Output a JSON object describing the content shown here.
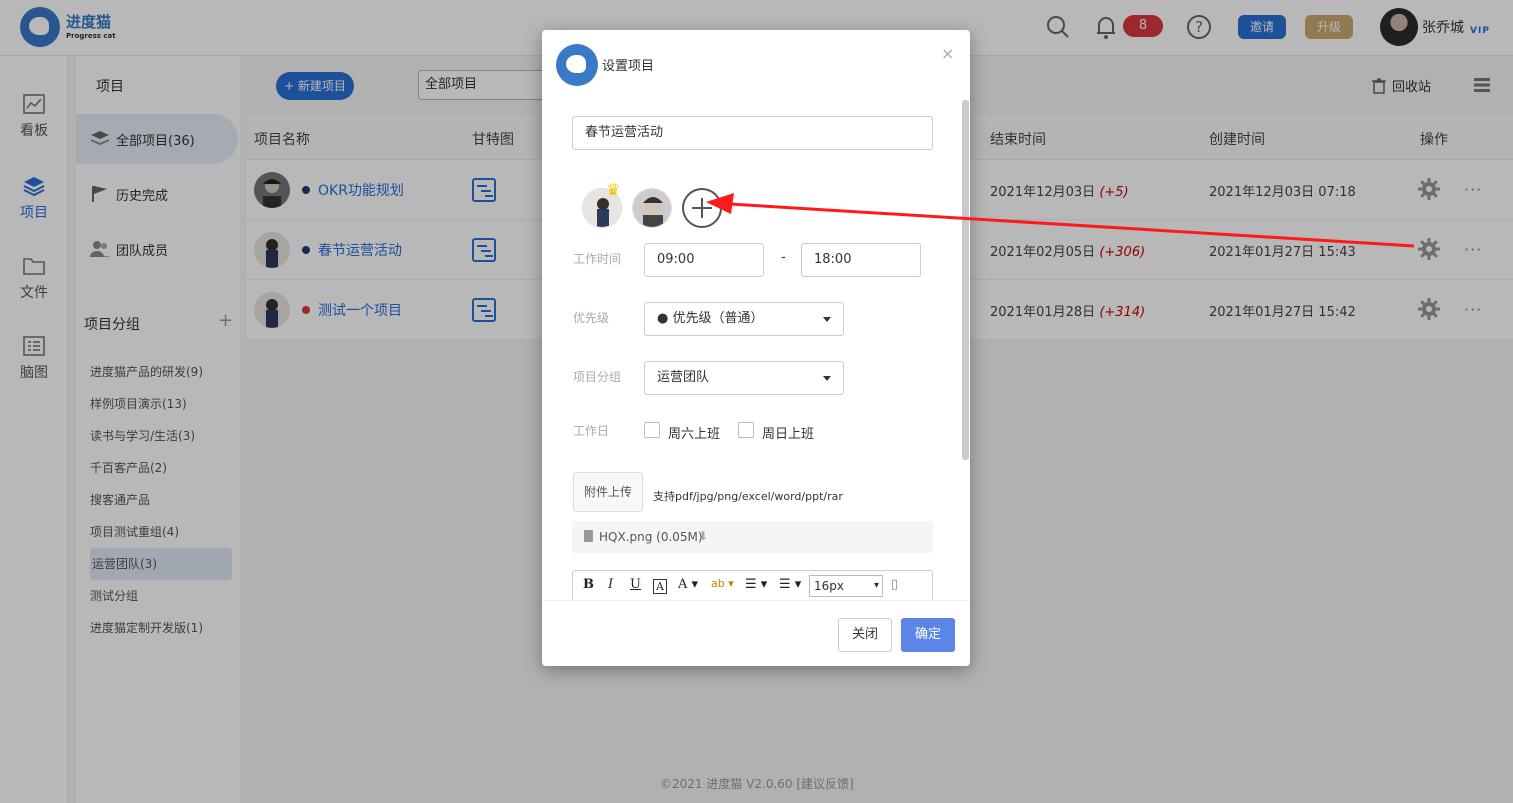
{
  "app": {
    "logo_cn": "进度猫",
    "logo_en": "Progress cat"
  },
  "topbar": {
    "notification_count": "8",
    "invite_label": "邀请",
    "upgrade_label": "升级",
    "user_name": "张乔城",
    "vip": "VIP"
  },
  "leftnav": [
    {
      "label": "看板",
      "icon": "chart-icon"
    },
    {
      "label": "项目",
      "icon": "layers-icon",
      "active": true
    },
    {
      "label": "文件",
      "icon": "folder-icon"
    },
    {
      "label": "脑图",
      "icon": "list-icon"
    }
  ],
  "subnav": {
    "title": "项目",
    "items": [
      {
        "label": "全部项目(36)",
        "icon": "layers-icon",
        "active": true
      },
      {
        "label": "历史完成",
        "icon": "flag-icon"
      },
      {
        "label": "团队成员",
        "icon": "users-icon"
      }
    ],
    "group_title": "项目分组",
    "group_add": "+",
    "groups": [
      "进度猫产品的研发(9)",
      "样例项目演示(13)",
      "读书与学习/生活(3)",
      "千百客产品(2)",
      "搜客通产品",
      "项目测试重组(4)",
      "运营团队(3)",
      "测试分组",
      "进度猫定制开发版(1)"
    ],
    "active_group_index": 6
  },
  "main": {
    "new_project_label": "+ 新建项目",
    "filter_value": "全部项目",
    "recycle_label": "回收站",
    "columns": [
      "项目名称",
      "甘特图",
      "结束时间",
      "创建时间",
      "操作"
    ],
    "rows": [
      {
        "name": "OKR功能规划",
        "dot_color": "#1e3c6e",
        "end": "2021年12月03日",
        "end_delta": "(+5)",
        "created": "2021年12月03日 07:18"
      },
      {
        "name": "春节运营活动",
        "dot_color": "#1e3c6e",
        "end": "2021年02月05日",
        "end_delta": "(+306)",
        "created": "2021年01月27日 15:43"
      },
      {
        "name": "测试一个项目",
        "dot_color": "#e0393e",
        "end": "2021年01月28日",
        "end_delta": "(+314)",
        "created": "2021年01月27日 15:42"
      }
    ],
    "footer": "©2021 进度猫 V2.0.60  [建议反馈]"
  },
  "modal": {
    "title": "设置项目",
    "close_icon": "×",
    "project_name": "春节运营活动",
    "work_time_label": "工作时间",
    "start_time": "09:00",
    "time_sep": "-",
    "end_time": "18:00",
    "priority_label": "优先级",
    "priority_value": "● 优先级（普通）",
    "group_label": "项目分组",
    "group_value": "运营团队",
    "workday_label": "工作日",
    "saturday_label": "周六上班",
    "sunday_label": "周日上班",
    "upload_label": "附件上传",
    "upload_hint": "支持pdf/jpg/png/excel/word/ppt/rar",
    "attachment": "HQX.png (0.05M)",
    "editor_fontsize": "16px",
    "btn_close": "关闭",
    "btn_ok": "确定"
  },
  "colors": {
    "accent": "#2a6fd6",
    "annotation_arrow": "#ff1a1a",
    "delta": "#cc0000"
  }
}
